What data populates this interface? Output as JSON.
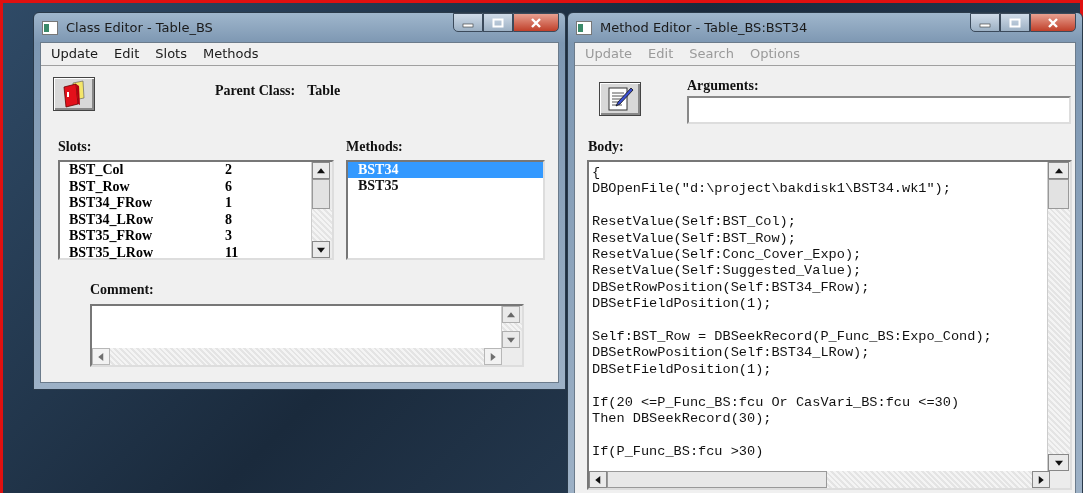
{
  "class_editor": {
    "title": "Class Editor - Table_BS",
    "menu": [
      {
        "label": "Update",
        "disabled": false
      },
      {
        "label": "Edit",
        "disabled": false
      },
      {
        "label": "Slots",
        "disabled": false
      },
      {
        "label": "Methods",
        "disabled": false
      }
    ],
    "parent_class_label": "Parent Class:",
    "parent_class": "Table",
    "slots_label": "Slots:",
    "slots": [
      {
        "name": "BST_Col",
        "value": "2"
      },
      {
        "name": "BST_Row",
        "value": "6"
      },
      {
        "name": "BST34_FRow",
        "value": "1"
      },
      {
        "name": "BST34_LRow",
        "value": "8"
      },
      {
        "name": "BST35_FRow",
        "value": "3"
      },
      {
        "name": "BST35_LRow",
        "value": "11"
      }
    ],
    "methods_label": "Methods:",
    "methods": [
      {
        "label": "BST34",
        "selected": true
      },
      {
        "label": "BST35",
        "selected": false
      }
    ],
    "comment_label": "Comment:"
  },
  "method_editor": {
    "title": "Method Editor - Table_BS:BST34",
    "menu": [
      {
        "label": "Update",
        "disabled": true
      },
      {
        "label": "Edit",
        "disabled": true
      },
      {
        "label": "Search",
        "disabled": true
      },
      {
        "label": "Options",
        "disabled": true
      }
    ],
    "arguments_label": "Arguments:",
    "body_label": "Body:",
    "body": "{\nDBOpenFile(\"d:\\project\\bakdisk1\\BST34.wk1\");\n\nResetValue(Self:BST_Col);\nResetValue(Self:BST_Row);\nResetValue(Self:Conc_Cover_Expo);\nResetValue(Self:Suggested_Value);\nDBSetRowPosition(Self:BST34_FRow);\nDBSetFieldPosition(1);\n\nSelf:BST_Row = DBSeekRecord(P_Func_BS:Expo_Cond);\nDBSetRowPosition(Self:BST34_LRow);\nDBSetFieldPosition(1);\n\nIf(20 <=P_Func_BS:fcu Or CasVari_BS:fcu <=30)\nThen DBSeekRecord(30);\n\nIf(P_Func_BS:fcu >30)"
  }
}
